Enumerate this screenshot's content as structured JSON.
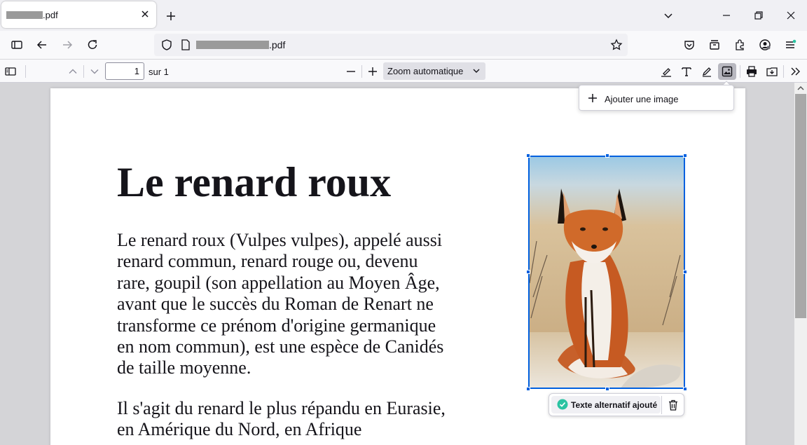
{
  "browser": {
    "tab": {
      "title": ".pdf",
      "close_icon": "close-icon"
    },
    "url": {
      "text": ".pdf"
    }
  },
  "pdf_toolbar": {
    "page_number": "1",
    "page_count_label": "sur 1",
    "zoom_value": "Zoom automatique"
  },
  "document": {
    "title": "Le renard roux",
    "paragraph1": "Le renard roux (Vulpes vulpes), appelé aussi renard commun, renard rouge ou, devenu rare, goupil (son appellation au Moyen Âge, avant que le succès du Roman de Renart ne transforme ce prénom d'origine germanique en nom commun), est une espèce de Canidés de taille moyenne.",
    "paragraph2": "Il s'agit du renard le plus répandu en Eurasie, en Amérique du Nord, en Afrique"
  },
  "image_editor": {
    "alt_text_status": "Texte alternatif ajouté",
    "image_subject": "fox-photo"
  },
  "add_image_menu": {
    "item_label": "Ajouter une image"
  },
  "colors": {
    "accent": "#0060df",
    "success": "#2ac3a2",
    "page_bg": "#d4d4d7",
    "toolbar_bg": "#f9f9fb"
  }
}
